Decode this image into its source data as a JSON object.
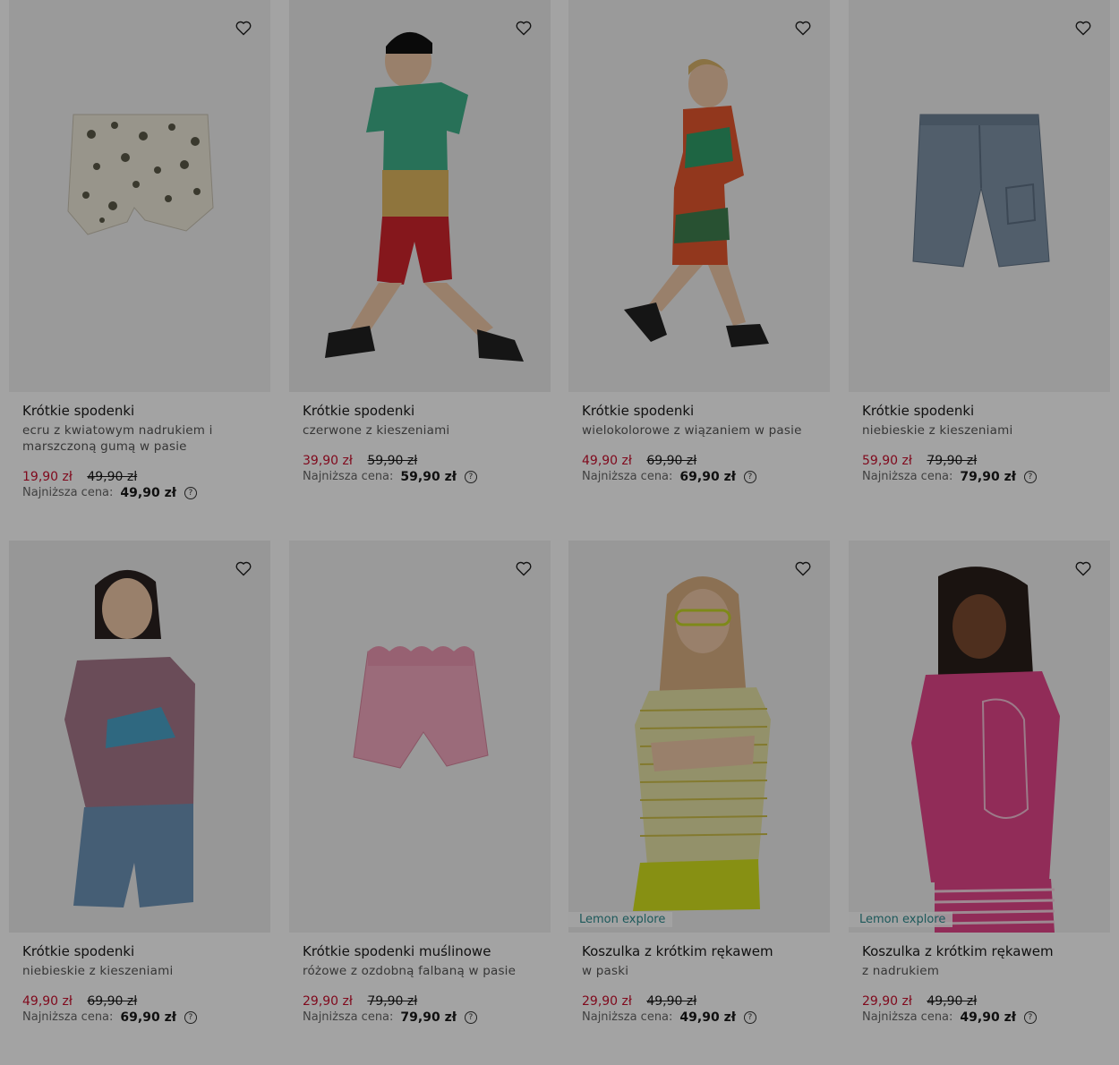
{
  "products": [
    {
      "title": "Krótkie spodenki",
      "subtitle": "ecru z kwiatowym nadrukiem i marszczoną gumą w pasie",
      "price_new": "19,90 zł",
      "price_old": "49,90 zł",
      "lowest_label": "Najniższa cena:",
      "lowest_value": "49,90 zł",
      "image": "floral-shorts-photo"
    },
    {
      "title": "Krótkie spodenki",
      "subtitle": "czerwone z kieszeniami",
      "price_new": "39,90 zł",
      "price_old": "59,90 zł",
      "lowest_label": "Najniższa cena:",
      "lowest_value": "59,90 zł",
      "image": "boy-red-shorts-photo"
    },
    {
      "title": "Krótkie spodenki",
      "subtitle": "wielokolorowe z wiązaniem w pasie",
      "price_new": "49,90 zł",
      "price_old": "69,90 zł",
      "lowest_label": "Najniższa cena:",
      "lowest_value": "69,90 zł",
      "image": "boy-multicolor-outfit-photo"
    },
    {
      "title": "Krótkie spodenki",
      "subtitle": "niebieskie z kieszeniami",
      "price_new": "59,90 zł",
      "price_old": "79,90 zł",
      "lowest_label": "Najniższa cena:",
      "lowest_value": "79,90 zł",
      "image": "denim-shorts-photo"
    },
    {
      "title": "Krótkie spodenki",
      "subtitle": "niebieskie z kieszeniami",
      "price_new": "49,90 zł",
      "price_old": "69,90 zł",
      "lowest_label": "Najniższa cena:",
      "lowest_value": "69,90 zł",
      "image": "girl-blue-shorts-photo"
    },
    {
      "title": "Krótkie spodenki muślinowe",
      "subtitle": "różowe z ozdobną falbaną w pasie",
      "price_new": "29,90 zł",
      "price_old": "79,90 zł",
      "lowest_label": "Najniższa cena:",
      "lowest_value": "79,90 zł",
      "image": "pink-muslin-shorts-photo"
    },
    {
      "title": "Koszulka z krótkim rękawem",
      "subtitle": "w paski",
      "price_new": "29,90 zł",
      "price_old": "49,90 zł",
      "lowest_label": "Najniższa cena:",
      "lowest_value": "49,90 zł",
      "brand": "Lemon explore",
      "image": "girl-striped-tshirt-photo"
    },
    {
      "title": "Koszulka z krótkim rękawem",
      "subtitle": "z nadrukiem",
      "price_new": "29,90 zł",
      "price_old": "49,90 zł",
      "lowest_label": "Najniższa cena:",
      "lowest_value": "49,90 zł",
      "brand": "Lemon explore",
      "image": "girl-pink-tshirt-photo"
    }
  ],
  "icons": {
    "favorite": "heart-outline-icon",
    "help": "question-circle-icon"
  },
  "colors": {
    "sale_price": "#c8102e",
    "brand_label": "#2e8c8f",
    "overlay": "rgba(0,0,0,0.36)"
  }
}
